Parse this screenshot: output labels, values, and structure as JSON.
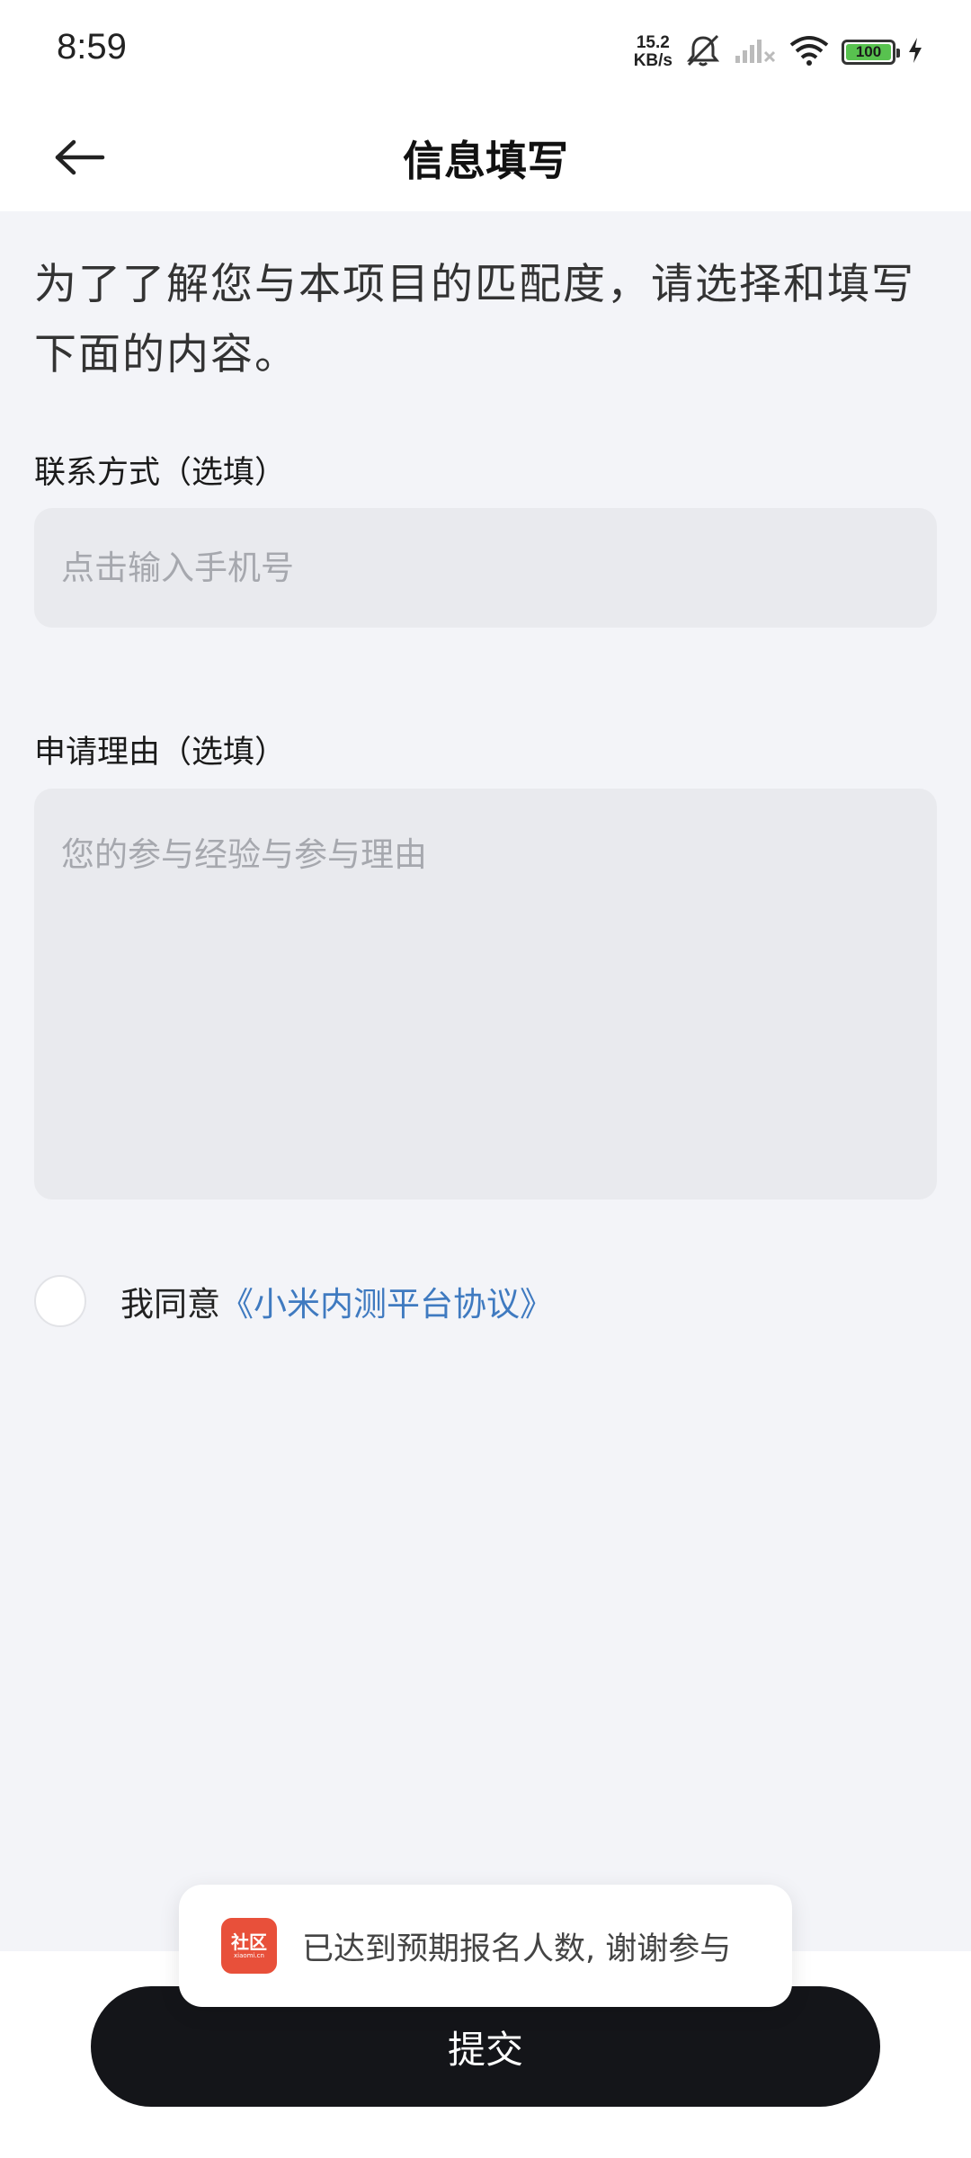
{
  "status_bar": {
    "time": "8:59",
    "net_speed_value": "15.2",
    "net_speed_unit": "KB/s",
    "battery": "100",
    "icons": [
      "mute-icon",
      "signal-off-icon",
      "wifi-icon",
      "battery-icon",
      "charging-icon"
    ]
  },
  "header": {
    "title": "信息填写",
    "back_icon": "back-arrow-icon"
  },
  "intro": "为了了解您与本项目的匹配度，请选择和填写下面的内容。",
  "contact": {
    "label": "联系方式（选填）",
    "placeholder": "点击输入手机号",
    "value": ""
  },
  "reason": {
    "label": "申请理由（选填）",
    "placeholder": "您的参与经验与参与理由",
    "value": ""
  },
  "agreement": {
    "checked": false,
    "text": "我同意",
    "link": "《小米内测平台协议》"
  },
  "submit_label": "提交",
  "toast": {
    "icon_text": "社区",
    "icon_subtext": "xiaomi.cn",
    "message": "已达到预期报名人数, 谢谢参与"
  },
  "colors": {
    "background": "#f3f4f8",
    "input_bg": "#e9eaee",
    "link": "#3f7ac0",
    "submit_bg": "#141519",
    "toast_icon": "#e8503a",
    "battery": "#58c24f"
  }
}
